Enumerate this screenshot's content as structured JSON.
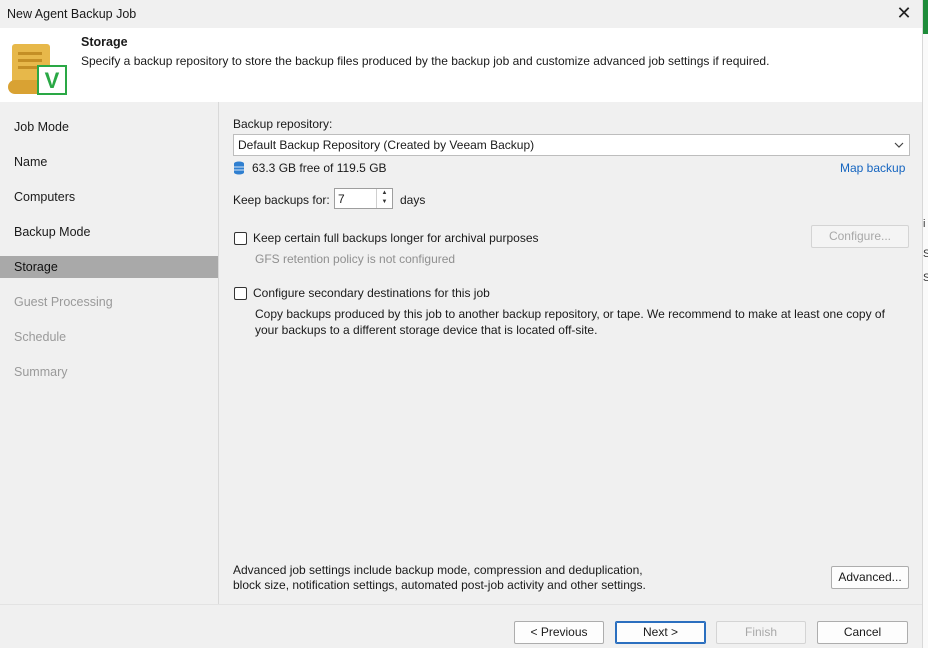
{
  "window": {
    "title": "New Agent Backup Job",
    "close_glyph": "✕"
  },
  "header": {
    "title": "Storage",
    "description": "Specify a backup repository to store the backup files produced by the backup job and customize advanced job settings if required.",
    "logo_letter": "V",
    "logo_icon": "scroll-with-checkmark-icon"
  },
  "steps": [
    {
      "label": "Job Mode",
      "state": "normal"
    },
    {
      "label": "Name",
      "state": "normal"
    },
    {
      "label": "Computers",
      "state": "normal"
    },
    {
      "label": "Backup Mode",
      "state": "normal"
    },
    {
      "label": "Storage",
      "state": "active"
    },
    {
      "label": "Guest Processing",
      "state": "disabled"
    },
    {
      "label": "Schedule",
      "state": "disabled"
    },
    {
      "label": "Summary",
      "state": "disabled"
    }
  ],
  "storage": {
    "repo_label": "Backup repository:",
    "repo_value": "Default Backup Repository (Created by Veeam Backup)",
    "free_space": "63.3 GB free of 119.5 GB",
    "map_backup_link": "Map backup",
    "keep_label": "Keep backups for:",
    "keep_value": "7",
    "keep_unit": "days",
    "gfs_checkbox_label": "Keep certain full backups longer for archival purposes",
    "gfs_checked": false,
    "configure_button": "Configure...",
    "gfs_status": "GFS retention policy is not configured",
    "secondary_checkbox_label": "Configure secondary destinations for this job",
    "secondary_checked": false,
    "secondary_desc_line1": "Copy backups produced by this job to another backup repository, or tape. We recommend to make at least one copy of",
    "secondary_desc_line2": "your backups to a different storage device that is located off-site.",
    "advanced_desc_line1": "Advanced job settings include backup mode, compression and deduplication,",
    "advanced_desc_line2": "block size, notification settings, automated post-job activity and other settings.",
    "advanced_button": "Advanced..."
  },
  "footer": {
    "previous": "< Previous",
    "next": "Next >",
    "finish": "Finish",
    "cancel": "Cancel"
  },
  "colors": {
    "accent": "#1565c0",
    "active_step": "#a9a9a9",
    "logo_green": "#2aa845",
    "logo_gold": "#e7b84a"
  },
  "edge_fragments": [
    "i",
    "Se",
    "Se"
  ]
}
